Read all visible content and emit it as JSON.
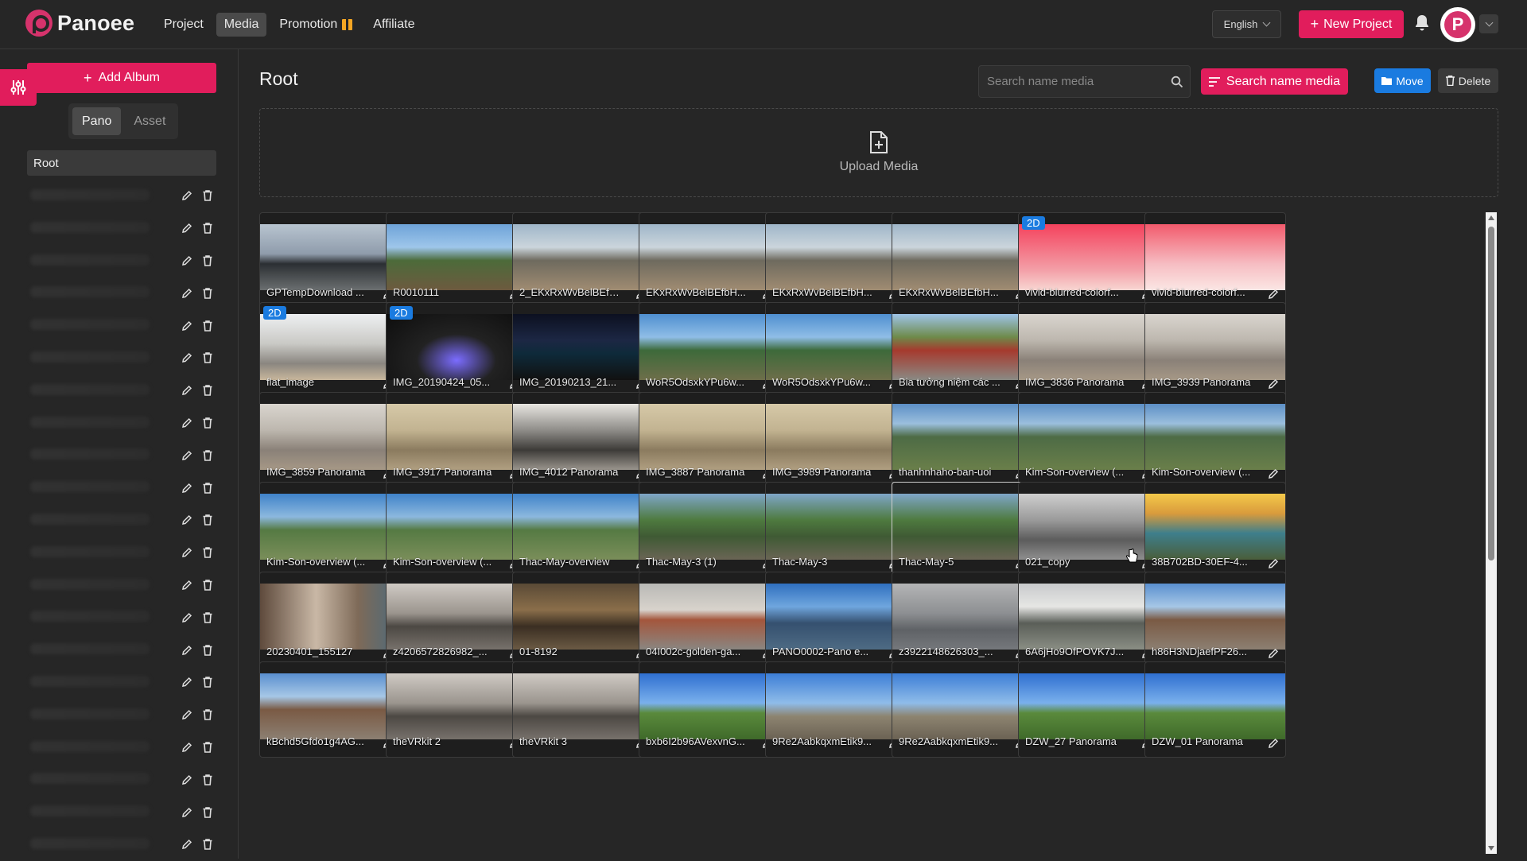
{
  "brand": {
    "name": "Panoee",
    "accent": "#e11d5c"
  },
  "nav": [
    {
      "label": "Project",
      "active": false
    },
    {
      "label": "Media",
      "active": true
    },
    {
      "label": "Promotion",
      "active": false,
      "icon": "gift-icon"
    },
    {
      "label": "Affiliate",
      "active": false
    }
  ],
  "header": {
    "language": "English",
    "new_project_label": "New Project",
    "avatar_letter": "P"
  },
  "sidebar": {
    "add_album_label": "Add Album",
    "tabs": [
      {
        "label": "Pano",
        "active": true
      },
      {
        "label": "Asset",
        "active": false
      }
    ],
    "root_label": "Root",
    "album_count": 21
  },
  "main": {
    "title": "Root",
    "search_placeholder": "Search name media",
    "search_button_label": "Search name media",
    "move_label": "Move",
    "delete_label": "Delete",
    "upload_label": "Upload Media"
  },
  "media": [
    {
      "name": "GPTempDownload ...",
      "theme": "sky-dusk"
    },
    {
      "name": "R0010111",
      "theme": "garden"
    },
    {
      "name": "2_EKxRxWvBelBEfb...",
      "theme": "beach"
    },
    {
      "name": "EKxRxWvBelBEfbH...",
      "theme": "beach"
    },
    {
      "name": "EKxRxWvBelBEfbH...",
      "theme": "beach"
    },
    {
      "name": "EKxRxWvBelBEfbH...",
      "theme": "beach"
    },
    {
      "name": "vivid-blurred-colorf...",
      "theme": "pink",
      "badge": "2D"
    },
    {
      "name": "vivid-blurred-colorf...",
      "theme": "pink-light"
    },
    {
      "name": "flat_image",
      "theme": "kitchen",
      "badge": "2D"
    },
    {
      "name": "IMG_20190424_05...",
      "theme": "dark",
      "badge": "2D"
    },
    {
      "name": "IMG_20190213_21...",
      "theme": "night"
    },
    {
      "name": "WoR5OdsxkYPu6w...",
      "theme": "field"
    },
    {
      "name": "WoR5OdsxkYPu6w...",
      "theme": "field"
    },
    {
      "name": "Bia tưởng niệm các ...",
      "theme": "temple"
    },
    {
      "name": "IMG_3836 Panorama",
      "theme": "room"
    },
    {
      "name": "IMG_3939 Panorama",
      "theme": "room"
    },
    {
      "name": "IMG_3859 Panorama",
      "theme": "room"
    },
    {
      "name": "IMG_3917 Panorama",
      "theme": "room-warm"
    },
    {
      "name": "IMG_4012 Panorama",
      "theme": "room-dark"
    },
    {
      "name": "IMG_3887 Panorama",
      "theme": "room-warm"
    },
    {
      "name": "IMG_3989 Panorama",
      "theme": "room-warm"
    },
    {
      "name": "thanhnhaho-ban-uoi",
      "theme": "mountain"
    },
    {
      "name": "Kim-Son-overview (...",
      "theme": "mountain"
    },
    {
      "name": "Kim-Son-overview (...",
      "theme": "mountain"
    },
    {
      "name": "Kim-Son-overview (...",
      "theme": "river"
    },
    {
      "name": "Kim-Son-overview (...",
      "theme": "river"
    },
    {
      "name": "Thac-May-overview",
      "theme": "river"
    },
    {
      "name": "Thac-May-3 (1)",
      "theme": "forest"
    },
    {
      "name": "Thac-May-3",
      "theme": "forest"
    },
    {
      "name": "Thac-May-5",
      "theme": "forest",
      "hover": true
    },
    {
      "name": "021_copy",
      "theme": "room-grey"
    },
    {
      "name": "38B702BD-30EF-4...",
      "theme": "sunset"
    },
    {
      "name": "20230401_155127",
      "theme": "stairs"
    },
    {
      "name": "z4206572826982_...",
      "theme": "studio"
    },
    {
      "name": "01-8192",
      "theme": "hall"
    },
    {
      "name": "04I002c-golden-ga...",
      "theme": "bridge"
    },
    {
      "name": "PANO0002-Pano e...",
      "theme": "city"
    },
    {
      "name": "z3922148626303_...",
      "theme": "city-grey"
    },
    {
      "name": "6A6jHo9OfPOVK7J...",
      "theme": "building"
    },
    {
      "name": "h86H3NDjaefPF26...",
      "theme": "street"
    },
    {
      "name": "kBchd5Gfdo1g4AG...",
      "theme": "street"
    },
    {
      "name": "theVRkit 2",
      "theme": "studio"
    },
    {
      "name": "theVRkit 3",
      "theme": "studio"
    },
    {
      "name": "bxb6I2b96AVexvnG...",
      "theme": "plains"
    },
    {
      "name": "9Re2AabkqxmEtik9...",
      "theme": "sky-blue"
    },
    {
      "name": "9Re2AabkqxmEtik9...",
      "theme": "sky-blue"
    },
    {
      "name": "DZW_27 Panorama",
      "theme": "plains"
    },
    {
      "name": "DZW_01 Panorama",
      "theme": "plains"
    }
  ]
}
